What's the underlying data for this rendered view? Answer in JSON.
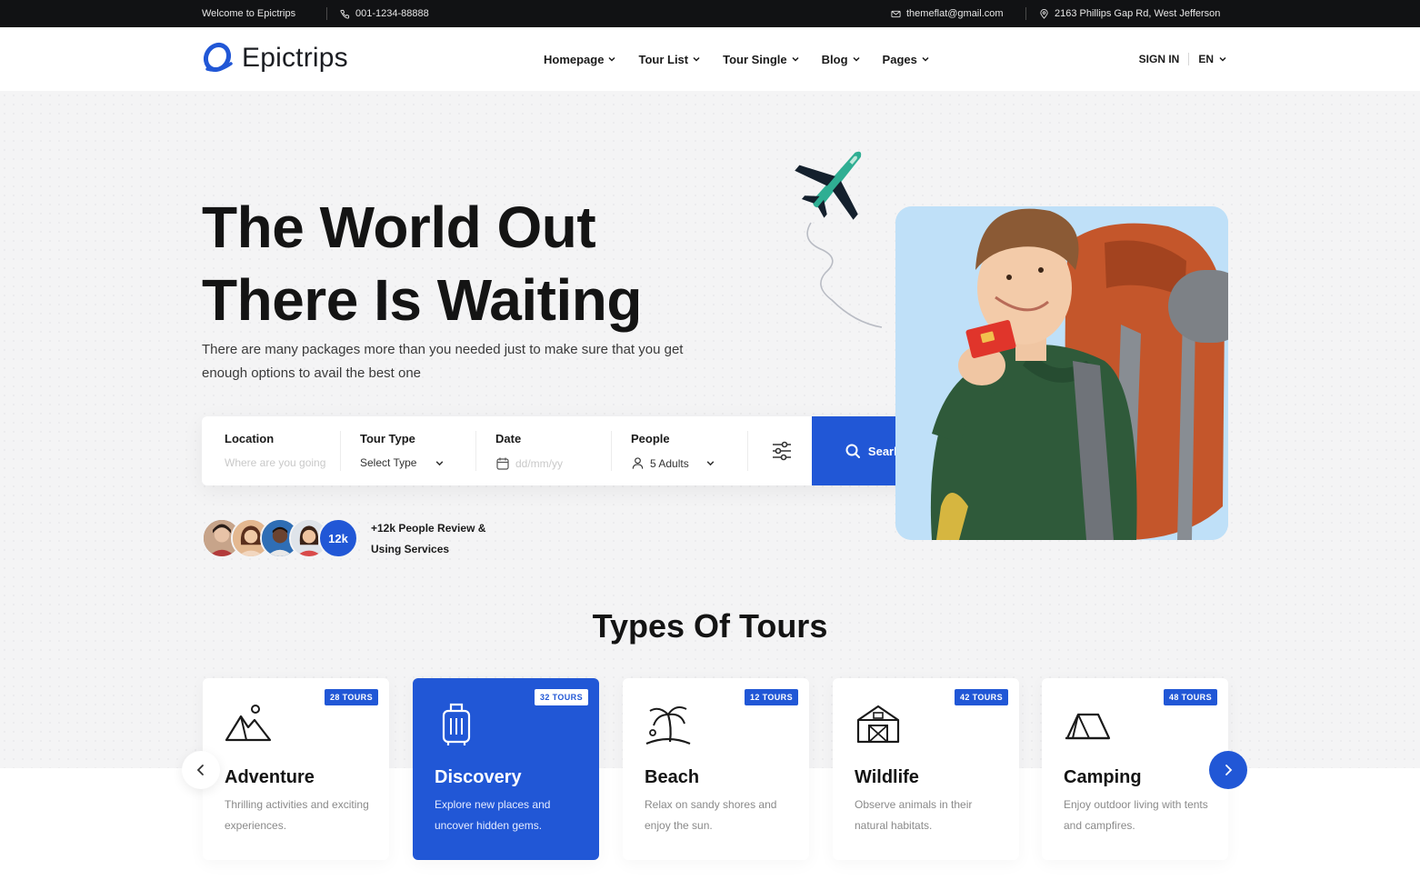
{
  "topbar": {
    "welcome": "Welcome to Epictrips",
    "phone": "001-1234-88888",
    "email": "themeflat@gmail.com",
    "address": "2163 Phillips Gap Rd, West Jefferson",
    "icons": {
      "phone": "phone-icon",
      "email": "mail-icon",
      "address": "map-pin-icon"
    }
  },
  "header": {
    "brand": "Epictrips",
    "nav": [
      {
        "label": "Homepage"
      },
      {
        "label": "Tour List"
      },
      {
        "label": "Tour Single"
      },
      {
        "label": "Blog"
      },
      {
        "label": "Pages"
      }
    ],
    "sign_in": "SIGN IN",
    "language": "EN"
  },
  "hero": {
    "title_line1": "The World Out",
    "title_line2": "There Is Waiting",
    "subtitle": "There are many packages more than you needed just to make sure that you get enough options to avail the best one"
  },
  "search": {
    "location": {
      "label": "Location",
      "placeholder": "Where are you going"
    },
    "tour_type": {
      "label": "Tour Type",
      "value": "Select Type"
    },
    "date": {
      "label": "Date",
      "placeholder": "dd/mm/yy"
    },
    "people": {
      "label": "People",
      "value": "5 Adults"
    },
    "button": "Searh"
  },
  "reviews": {
    "count_badge": "12k",
    "text": "+12k People Review & Using Services"
  },
  "tours": {
    "title": "Types Of Tours",
    "items": [
      {
        "name": "Adventure",
        "badge": "28 TOURS",
        "desc": "Thrilling activities and exciting experiences.",
        "icon": "mountain-icon",
        "active": false
      },
      {
        "name": "Discovery",
        "badge": "32 TOURS",
        "desc": "Explore new places and uncover hidden gems.",
        "icon": "luggage-icon",
        "active": true
      },
      {
        "name": "Beach",
        "badge": "12 TOURS",
        "desc": "Relax on sandy shores and enjoy the sun.",
        "icon": "palm-tree-icon",
        "active": false
      },
      {
        "name": "Wildlife",
        "badge": "42 TOURS",
        "desc": "Observe animals in their natural habitats.",
        "icon": "barn-icon",
        "active": false
      },
      {
        "name": "Camping",
        "badge": "48 TOURS",
        "desc": "Enjoy outdoor living with tents and campfires.",
        "icon": "tent-icon",
        "active": false
      }
    ]
  },
  "colors": {
    "accent": "#2157d6",
    "topbar": "#111214",
    "hero_bg": "#f4f4f5",
    "card_sky": "#bfe0f8"
  }
}
